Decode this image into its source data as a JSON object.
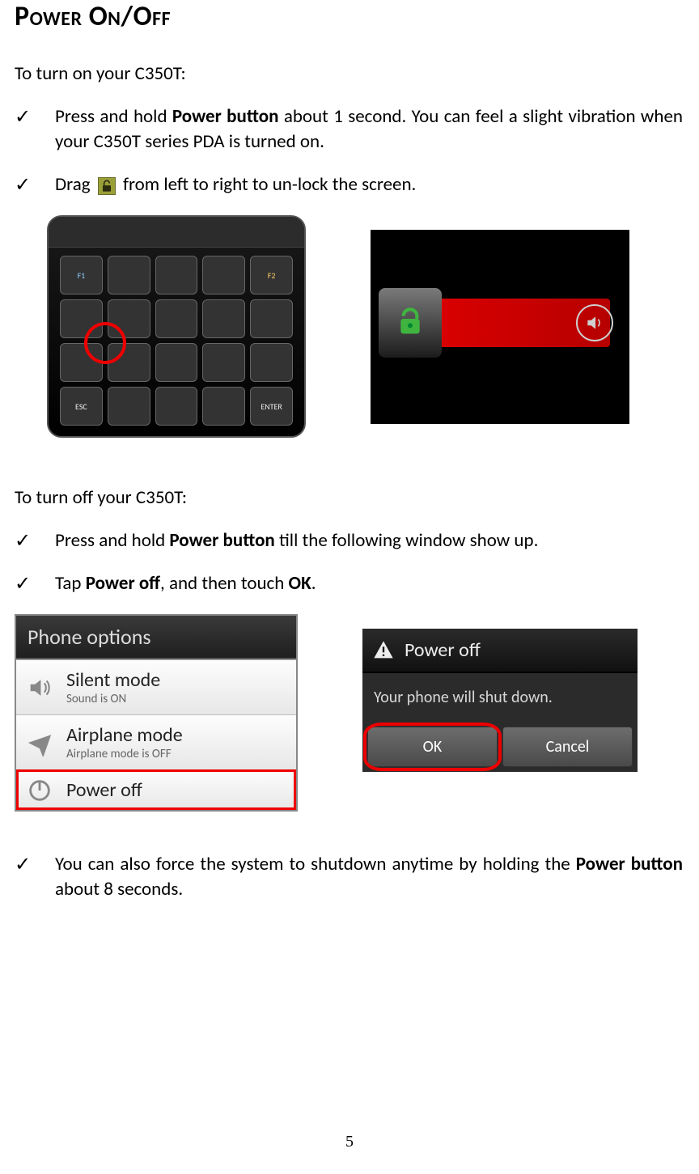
{
  "heading": "Power On/Off",
  "turn_on_intro": "To turn on your C350T:",
  "turn_on_items": {
    "a_pre": "Press and hold ",
    "a_bold": "Power button",
    "a_post": " about 1 second. You can feel a slight vibration when your C350T series PDA is turned on.",
    "b_pre": "Drag ",
    "b_post": " from left to right to un-lock the screen."
  },
  "turn_off_intro": "To turn off your C350T:",
  "turn_off_items": {
    "a_pre": "Press and hold ",
    "a_bold": "Power button",
    "a_post": " till the following window show up.",
    "b_pre": "Tap ",
    "b_bold1": "Power off",
    "b_mid": ", and then touch ",
    "b_bold2": "OK",
    "b_post": ".",
    "c_pre": "You can also force the system to shutdown anytime by holding the ",
    "c_bold": "Power button",
    "c_post": " about 8 seconds."
  },
  "device_keys": {
    "f1": "F1",
    "f2": "F2",
    "esc": "ESC",
    "enter": "ENTER"
  },
  "phone_options": {
    "title": "Phone options",
    "silent_title": "Silent mode",
    "silent_sub": "Sound is ON",
    "airplane_title": "Airplane mode",
    "airplane_sub": "Airplane mode is OFF",
    "poweroff_title": "Power off"
  },
  "poweroff_dialog": {
    "title": "Power off",
    "body": "Your phone will shut down.",
    "ok": "OK",
    "cancel": "Cancel"
  },
  "page_number": "5"
}
